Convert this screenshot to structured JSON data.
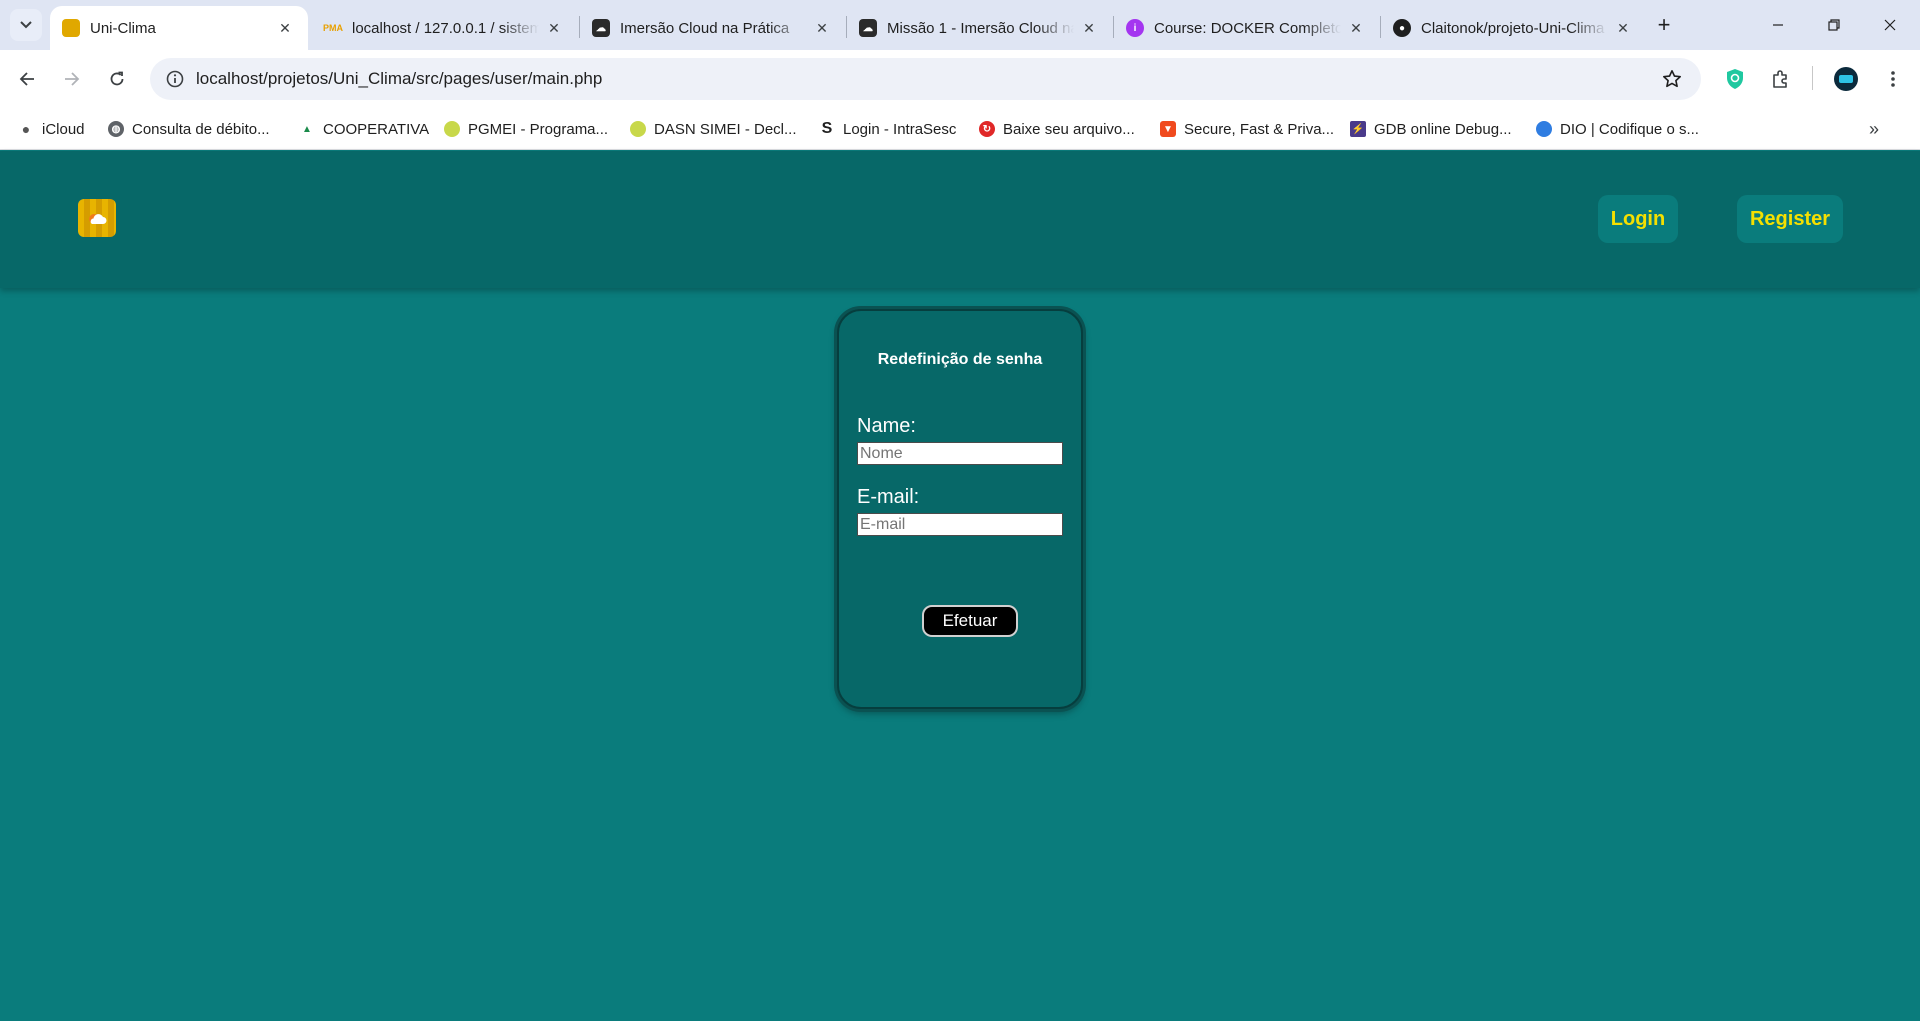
{
  "browser": {
    "tabs": [
      {
        "title": "Uni-Clima",
        "active": true,
        "icon": "uni-clima-favicon"
      },
      {
        "title": "localhost / 127.0.0.1 / sistema",
        "active": false,
        "icon": "phpmyadmin-favicon"
      },
      {
        "title": "Imersão Cloud na Prática",
        "active": false,
        "icon": "cloud-favicon"
      },
      {
        "title": "Missão 1 - Imersão Cloud na Prática",
        "active": false,
        "icon": "cloud-favicon"
      },
      {
        "title": "Course: DOCKER Completo",
        "active": false,
        "icon": "course-favicon"
      },
      {
        "title": "Claitonok/projeto-Uni-Clima",
        "active": false,
        "icon": "github-favicon"
      }
    ],
    "address_bar": {
      "url": "localhost/projetos/Uni_Clima/src/pages/user/main.php"
    },
    "bookmarks": [
      {
        "label": "iCloud",
        "icon": "apple-icon"
      },
      {
        "label": "Consulta de débito...",
        "icon": "globe-icon"
      },
      {
        "label": "COOPERATIVA",
        "icon": "cooperativa-icon"
      },
      {
        "label": "PGMEI - Programa...",
        "icon": "pgmei-icon"
      },
      {
        "label": "DASN SIMEI - Decl...",
        "icon": "dasn-icon"
      },
      {
        "label": "Login - IntraSesc",
        "icon": "sesc-icon"
      },
      {
        "label": "Baixe seu arquivo...",
        "icon": "download-site-icon"
      },
      {
        "label": "Secure, Fast & Priva...",
        "icon": "brave-icon"
      },
      {
        "label": "GDB online Debug...",
        "icon": "gdb-icon"
      },
      {
        "label": "DIO | Codifique o s...",
        "icon": "dio-icon"
      }
    ]
  },
  "site": {
    "header": {
      "logo_icon": "uni-clima-logo",
      "login_label": "Login",
      "register_label": "Register"
    },
    "reset_form": {
      "title": "Redefinição de senha",
      "name_label": "Name:",
      "name_placeholder": "Nome",
      "email_label": "E-mail:",
      "email_placeholder": "E-mail",
      "submit_label": "Efetuar"
    }
  },
  "colors": {
    "page_background": "#0a7c7c",
    "header_background": "#076868",
    "accent_text": "#f5e000",
    "submit_button": "#000000"
  }
}
